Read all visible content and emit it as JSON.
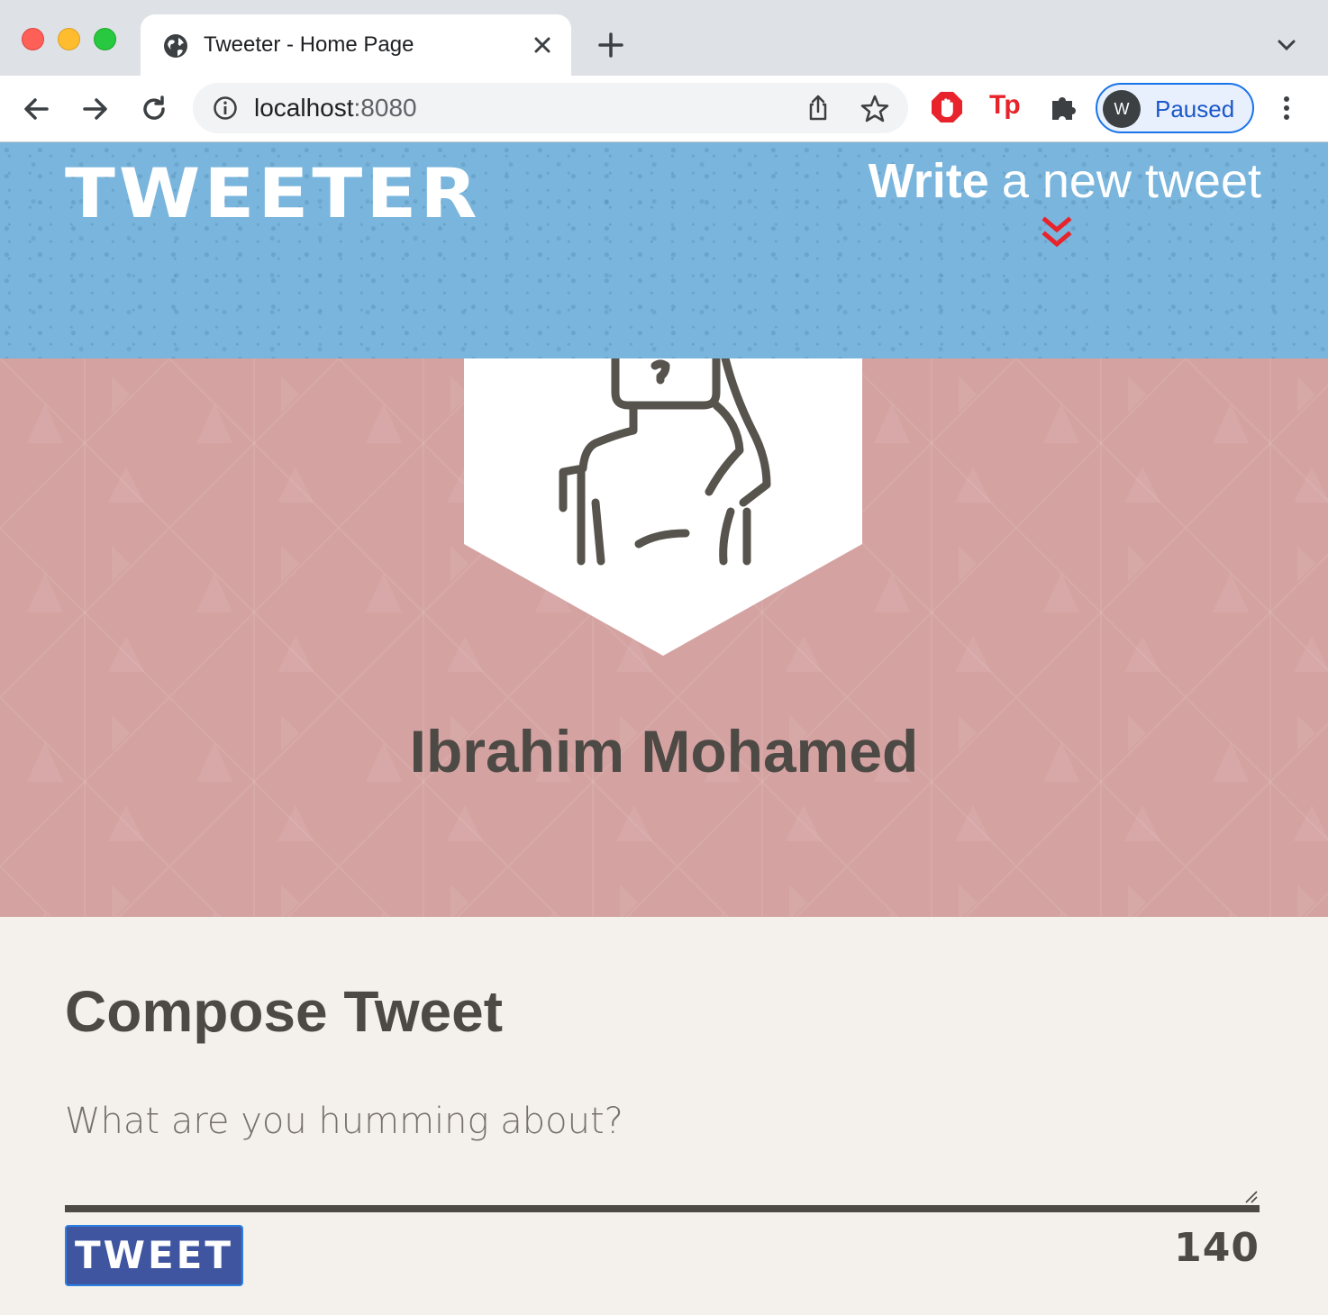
{
  "browser": {
    "tab_title": "Tweeter - Home Page",
    "url_host": "localhost",
    "url_port": ":8080",
    "profile_initial": "W",
    "profile_status": "Paused",
    "extension_tp_label": "Tp"
  },
  "header": {
    "logo": "TWEETER",
    "write_bold": "Write",
    "write_rest": "a new tweet"
  },
  "profile": {
    "name": "Ibrahim Mohamed"
  },
  "compose": {
    "title": "Compose Tweet",
    "placeholder": "What are you humming about?",
    "button_label": "TWEET",
    "counter": "140"
  },
  "colors": {
    "header_bg": "#79b5dc",
    "profile_bg": "#d4a3a1",
    "compose_bg": "#f4f1ec",
    "button_bg": "#3f55a0",
    "chevron": "#e8232b",
    "text_dark": "#4d4945"
  }
}
